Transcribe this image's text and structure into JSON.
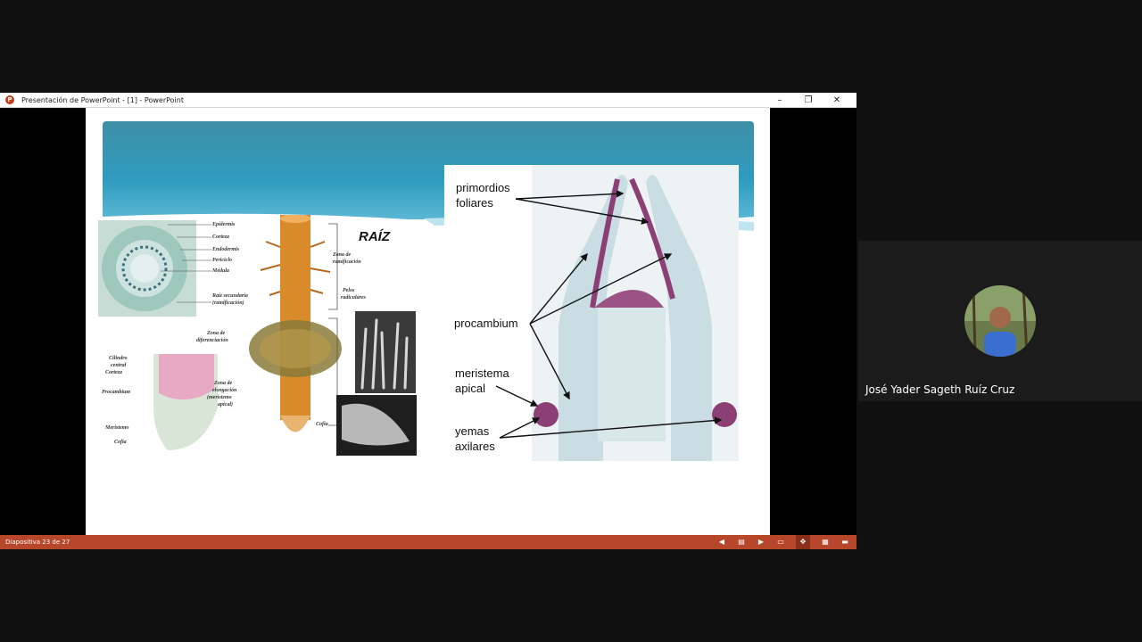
{
  "window": {
    "title": "Presentación de PowerPoint - [1] - PowerPoint",
    "app_icon": "P",
    "controls": {
      "minimize": "–",
      "restore": "❐",
      "close": "✕"
    }
  },
  "slide": {
    "title": "RAÍZ",
    "left_figure": {
      "cross_section_labels": [
        "Epidermis",
        "Corteza",
        "Endodermis",
        "Periciclo",
        "Médula",
        "Raíz secundaria",
        "(ramificación)"
      ],
      "tip_labels": [
        "Cilindro",
        "central",
        "Corteza",
        "Procambium",
        "Meristemo",
        "Cofia"
      ],
      "root_labels": [
        "Zona de",
        "ramificación",
        "Pelos",
        "radiculares",
        "Zona de",
        "diferenciación",
        "Zona de",
        "elongación",
        "(meristemo",
        "apical)",
        "Cofia"
      ]
    },
    "right_figure": {
      "labels": [
        "primordios",
        "foliares",
        "procambium",
        "meristema",
        "apical",
        "yemas",
        "axilares"
      ]
    }
  },
  "statusbar": {
    "slide_number": "Diapositiva 23 de 27",
    "accent": "#b7472a"
  },
  "participant": {
    "name": "José Yader Sageth Ruíz Cruz"
  }
}
